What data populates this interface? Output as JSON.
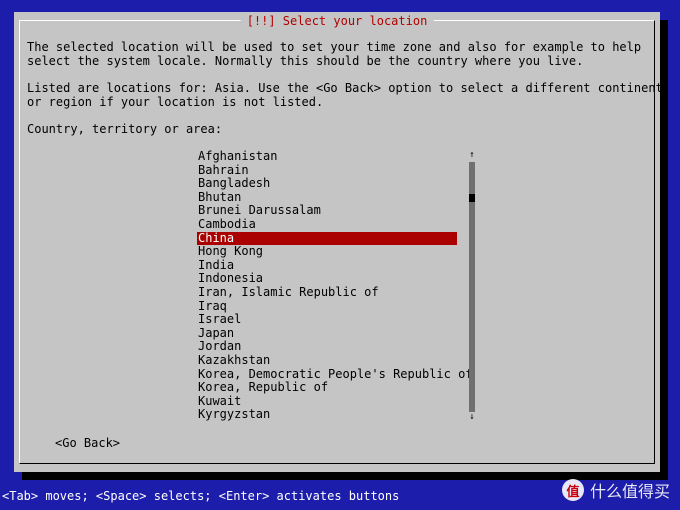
{
  "dialog": {
    "title": "[!!] Select your location",
    "intro_lines": [
      "The selected location will be used to set your time zone and also for example to help",
      "select the system locale. Normally this should be the country where you live."
    ],
    "listed_lines": [
      "Listed are locations for: Asia. Use the <Go Back> option to select a different continent",
      "or region if your location is not listed."
    ],
    "prompt": "Country, territory or area:",
    "countries": [
      "Afghanistan",
      "Bahrain",
      "Bangladesh",
      "Bhutan",
      "Brunei Darussalam",
      "Cambodia",
      "China",
      "Hong Kong",
      "India",
      "Indonesia",
      "Iran, Islamic Republic of",
      "Iraq",
      "Israel",
      "Japan",
      "Jordan",
      "Kazakhstan",
      "Korea, Democratic People's Republic of",
      "Korea, Republic of",
      "Kuwait",
      "Kyrgyzstan"
    ],
    "selected_country": "China",
    "scroll": {
      "up_arrow": "↑",
      "down_arrow": "↓"
    },
    "go_back_label": "<Go Back>"
  },
  "statusbar": {
    "text": "<Tab> moves; <Space> selects; <Enter> activates buttons"
  },
  "watermark": {
    "text": "什么值得买",
    "logo_text": "值"
  },
  "colors": {
    "background": "#1d1dab",
    "dialog": "#c5c5c5",
    "title": "#b00000",
    "selection": "#aa0000"
  }
}
